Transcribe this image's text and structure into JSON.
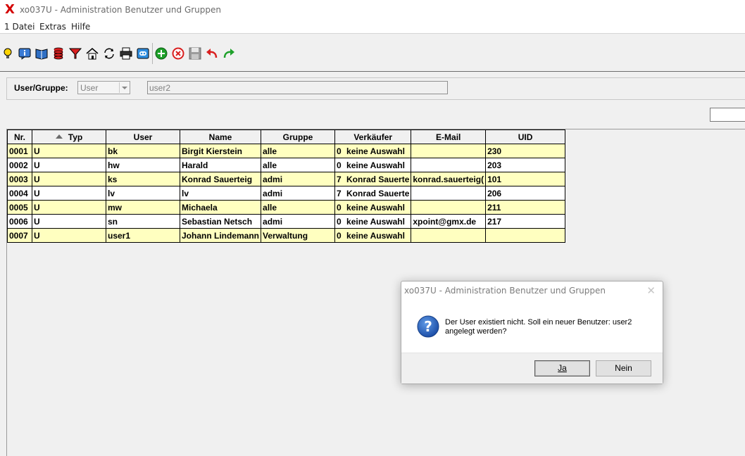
{
  "window": {
    "title": "xo037U - Administration Benutzer und Gruppen",
    "app_icon": "red-x-logo"
  },
  "menu": {
    "items": [
      {
        "label": "1 Datei"
      },
      {
        "label": "Extras"
      },
      {
        "label": "Hilfe"
      }
    ]
  },
  "toolbar": {
    "icons": [
      "lightbulb-icon",
      "info-icon",
      "book-icon",
      "database-icon",
      "filter-icon",
      "home-icon",
      "refresh-icon",
      "print-icon",
      "screen-icon",
      "add-icon",
      "delete-icon",
      "save-icon",
      "undo-icon",
      "redo-icon"
    ]
  },
  "filter": {
    "label": "User/Gruppe:",
    "type_value": "User",
    "user_value": "user2"
  },
  "grid": {
    "columns": [
      "Nr.",
      "Typ",
      "User",
      "Name",
      "Gruppe",
      "Verkäufer",
      "E-Mail",
      "UID"
    ],
    "rows": [
      {
        "nr": "0001",
        "typ": "U",
        "user": "bk",
        "name": "Birgit Kierstein",
        "gruppe": "alle",
        "vk_code": "0",
        "vk_name": "keine Auswahl",
        "email": "",
        "uid": "230"
      },
      {
        "nr": "0002",
        "typ": "U",
        "user": "hw",
        "name": "Harald",
        "gruppe": "alle",
        "vk_code": "0",
        "vk_name": "keine Auswahl",
        "email": "",
        "uid": "203"
      },
      {
        "nr": "0003",
        "typ": "U",
        "user": "ks",
        "name": "Konrad Sauerteig",
        "gruppe": "admi",
        "vk_code": "7",
        "vk_name": "Konrad Sauerte",
        "email": "konrad.sauerteig(",
        "uid": "101"
      },
      {
        "nr": "0004",
        "typ": "U",
        "user": "lv",
        "name": "lv",
        "gruppe": "admi",
        "vk_code": "7",
        "vk_name": "Konrad Sauerte",
        "email": "",
        "uid": "206"
      },
      {
        "nr": "0005",
        "typ": "U",
        "user": "mw",
        "name": "Michaela",
        "gruppe": "alle",
        "vk_code": "0",
        "vk_name": "keine Auswahl",
        "email": "",
        "uid": "211"
      },
      {
        "nr": "0006",
        "typ": "U",
        "user": "sn",
        "name": "Sebastian Netsch",
        "gruppe": "admi",
        "vk_code": "0",
        "vk_name": "keine Auswahl",
        "email": "xpoint@gmx.de",
        "uid": "217"
      },
      {
        "nr": "0007",
        "typ": "U",
        "user": "user1",
        "name": "Johann Lindemann",
        "gruppe": "Verwaltung",
        "vk_code": "0",
        "vk_name": "keine Auswahl",
        "email": "",
        "uid": ""
      }
    ]
  },
  "dialog": {
    "title": "xo037U - Administration Benutzer und Gruppen",
    "icon": "question-icon",
    "message_line1": "Der User existiert nicht. Soll ein neuer Benutzer: user2",
    "message_line2": "angelegt werden?",
    "yes_label": "Ja",
    "no_label": "Nein"
  }
}
